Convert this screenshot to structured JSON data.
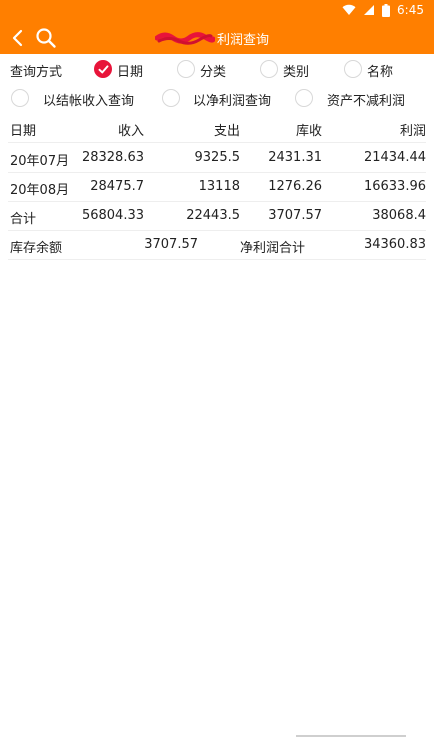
{
  "status": {
    "time": "6:45"
  },
  "header": {
    "title": "利润查询"
  },
  "query": {
    "label": "查询方式",
    "options": [
      "日期",
      "分类",
      "类别",
      "名称"
    ],
    "selected": "日期",
    "checkboxes": [
      "以结帐收入查询",
      "以净利润查询",
      "资产不减利润"
    ]
  },
  "table": {
    "columns": [
      "日期",
      "收入",
      "支出",
      "库收",
      "利润"
    ],
    "rows": [
      [
        "20年07月",
        "28328.63",
        "9325.5",
        "2431.31",
        "21434.44"
      ],
      [
        "20年08月",
        "28475.7",
        "13118",
        "1276.26",
        "16633.96"
      ]
    ],
    "total": [
      "合计",
      "56804.33",
      "22443.5",
      "3707.57",
      "38068.4"
    ]
  },
  "summary": {
    "inventory_label": "库存余额",
    "inventory_value": "3707.57",
    "net_label": "净利润合计",
    "net_value": "34360.83"
  },
  "colors": {
    "appbar": "#ff7f00",
    "radio_checked": "#e8143a"
  }
}
